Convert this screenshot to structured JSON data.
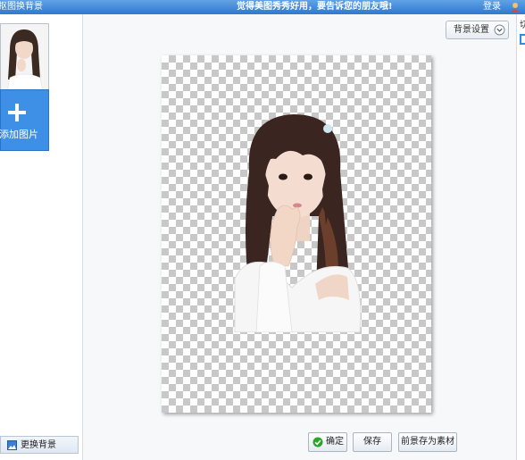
{
  "titlebar": {
    "app_title": "抠图换背景",
    "slogan": "觉得美图秀秀好用，要告诉您的朋友哦!",
    "login": "登录"
  },
  "left_panel": {
    "add_image_label": "添加图片",
    "replace_bg_label": "更换背景"
  },
  "toolbar": {
    "bg_settings_label": "背景设置"
  },
  "actions": {
    "confirm_label": "确定",
    "save_label": "保存",
    "save_foreground_label": "前景存为素材"
  },
  "right_strip": {
    "cut_label": "切"
  },
  "colors": {
    "titlebar": "#2f78cf",
    "add_button": "#3d90e6",
    "confirm_check": "#2aa52a"
  },
  "icons": [
    "user-icon",
    "plus-icon",
    "replace-bg-icon",
    "chevron-down-icon",
    "check-icon"
  ]
}
